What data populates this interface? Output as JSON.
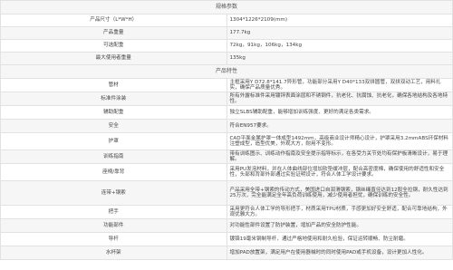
{
  "specs": {
    "title": "规格参数",
    "rows": [
      {
        "label": "产品尺寸（L*W*H）",
        "value": "1304*1226*2109(mm)"
      },
      {
        "label": "产品重量",
        "value": "177.7kg"
      },
      {
        "label": "可选配重",
        "value": "72kg，91kg，106kg，134kg"
      },
      {
        "label": "最大使用者重量",
        "value": "135kg"
      }
    ]
  },
  "features": {
    "title": "产品特性",
    "rows": [
      {
        "label": "管材",
        "value": "主框采用Y D72.8*141.7异形管，功能部分采用Y D40*133双拼圆管，双拼双动工艺，用料扎实，确保产品质量优秀。"
      },
      {
        "label": "标准件涂装",
        "value": "所有外露标准件采用镀锌表面涂层和不锈钢件，抗老化、抗腐蚀、抗老化，确保各地结构及各地特性。"
      },
      {
        "label": "辅助配重",
        "value": "独立SLBS辅助配重，能够增加训练强度、更好的满足各类需求。"
      },
      {
        "label": "安全",
        "value": "符合EN957要求。"
      },
      {
        "label": "护罩",
        "value": "CAD平面金属护罩一体成型1492mm，高级商业设计师精心设计，护罩采用3.2mmABS环保材料注塑成型，造型优美，外观大方，耐用不变形。"
      },
      {
        "label": "训练指南",
        "value": "带有训练图示、训练动作指南及安全提示指导标示，在各受力关节处均有保护板清晰设计，易于理解。"
      },
      {
        "label": "座椅/靠背",
        "value": "采用PU发泡材料，并在人体曲线部位增加软垫缓冲层，配合高密度棉，确保使用的舒适性和安全性，头部和背部外部通过实验证明设计，符合人体工学设计要求。"
      },
      {
        "label": "连带+钢索",
        "value": "产品采用全带+钢索的传动方式，美国进口自润滑钢索，钢丝绳直径达到12股全拉钢，耐久性达到25万次，完全能满足全年高负荷训练使用，减少使用者担忧，确保训练的安全性。"
      },
      {
        "label": "把手",
        "value": "采用更符合人体工学的导形把手，材质采用TPU材质，手感更加好安全舒适，配合可靠地结构，外观优雅大方。"
      },
      {
        "label": "功能部件",
        "value": "对功能性部件设置了防护装置，增加产品的安全防护性能。"
      },
      {
        "label": "导杆",
        "value": "镀铬19毫米钢制导杆，通过严格地使用和耐久检验，保证运转顺畅、防尘耐磨。"
      },
      {
        "label": "水杯架",
        "value": "增加PAD放置架，满足用户在使用器械时的同时使用PAD或手机设备，设计更加人性化。"
      }
    ]
  }
}
